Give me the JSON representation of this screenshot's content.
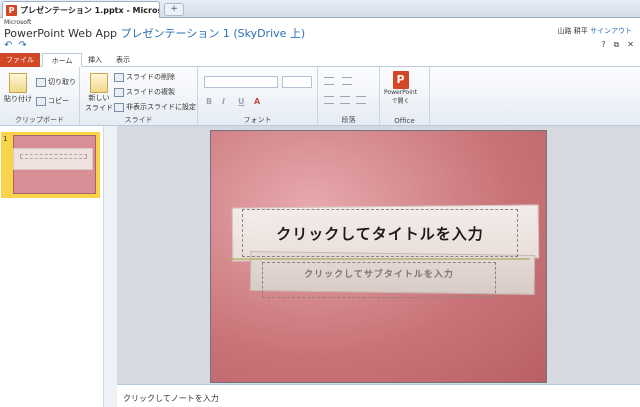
{
  "browser": {
    "tab_title": "プレゼンテーション 1.pptx - Micros...",
    "tab_close": "x",
    "new_tab": "+"
  },
  "header": {
    "brand": "Microsoft",
    "app_name": "PowerPoint Web App",
    "doc_title": "プレゼンテーション 1 (SkyDrive 上)",
    "user_name": "山路 耕平",
    "sign_out": "サインアウト"
  },
  "quick_access": {
    "undo": "↶",
    "redo": "↷"
  },
  "window_controls": {
    "help": "?",
    "restore": "⧉",
    "close": "✕"
  },
  "ribbon_tabs": [
    {
      "label": "ファイル"
    },
    {
      "label": "ホーム"
    },
    {
      "label": "挿入"
    },
    {
      "label": "表示"
    }
  ],
  "ribbon": {
    "clipboard": {
      "paste": "貼り付け",
      "cut": "切り取り",
      "copy": "コピー",
      "group_label": "クリップボード"
    },
    "slides": {
      "new_slide_line1": "新しい",
      "new_slide_line2": "スライド",
      "delete_slide": "スライドの削除",
      "duplicate_slide": "スライドの複製",
      "hide_slide": "非表示スライドに設定",
      "group_label": "スライド"
    },
    "font": {
      "bold": "B",
      "italic": "I",
      "underline": "U",
      "font_color": "A",
      "group_label": "フォント"
    },
    "paragraph": {
      "group_label": "段落"
    },
    "office": {
      "open_line1": "PowerPoint",
      "open_line2": "で開く",
      "group_label": "Office"
    }
  },
  "slide_panel": {
    "thumbnail_number": "1"
  },
  "slide": {
    "title_placeholder": "クリックしてタイトルを入力",
    "subtitle_placeholder": "クリックしてサブタイトルを入力"
  },
  "notes": {
    "placeholder": "クリックしてノートを入力"
  },
  "colors": {
    "accent_file_tab": "#d24726",
    "link_blue": "#2a6fb5",
    "selection_yellow": "#f9d34a"
  }
}
